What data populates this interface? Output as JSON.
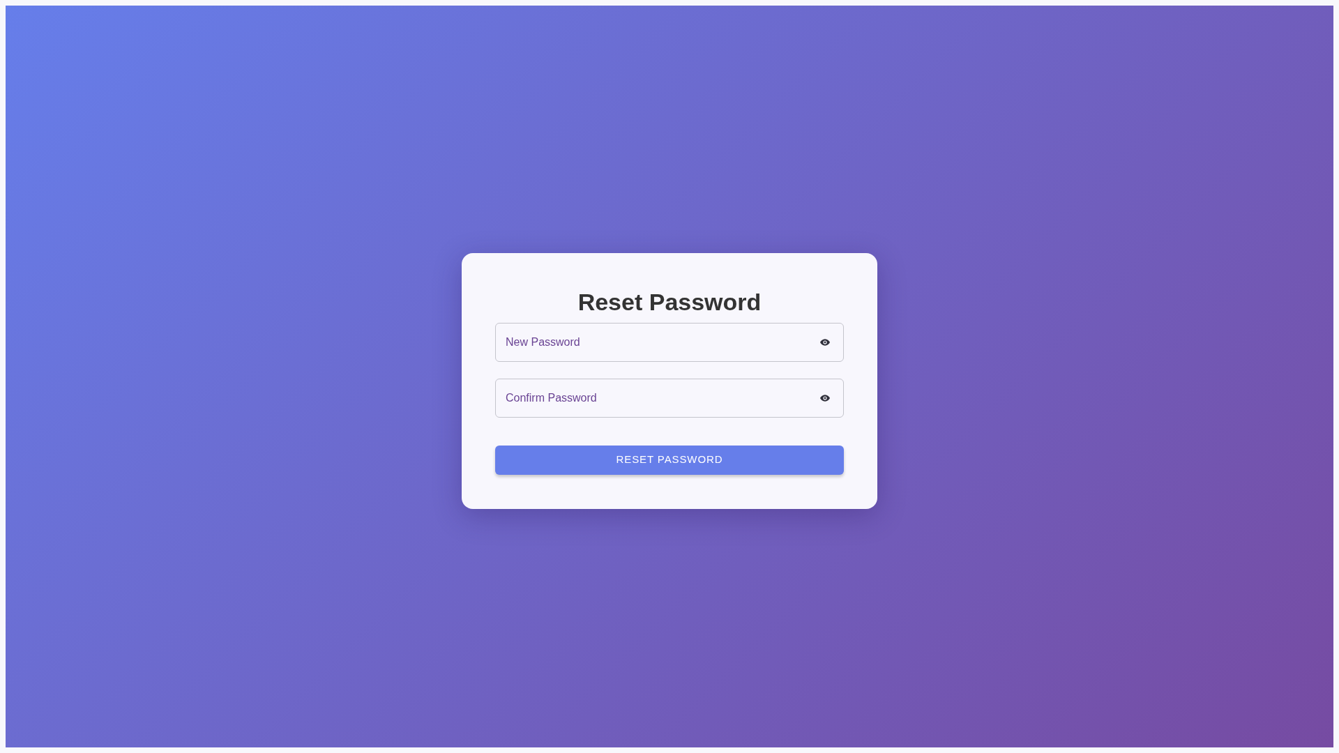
{
  "title": "Reset Password",
  "fields": [
    {
      "placeholder": "New Password"
    },
    {
      "placeholder": "Confirm Password"
    }
  ],
  "button": "RESET PASSWORD"
}
